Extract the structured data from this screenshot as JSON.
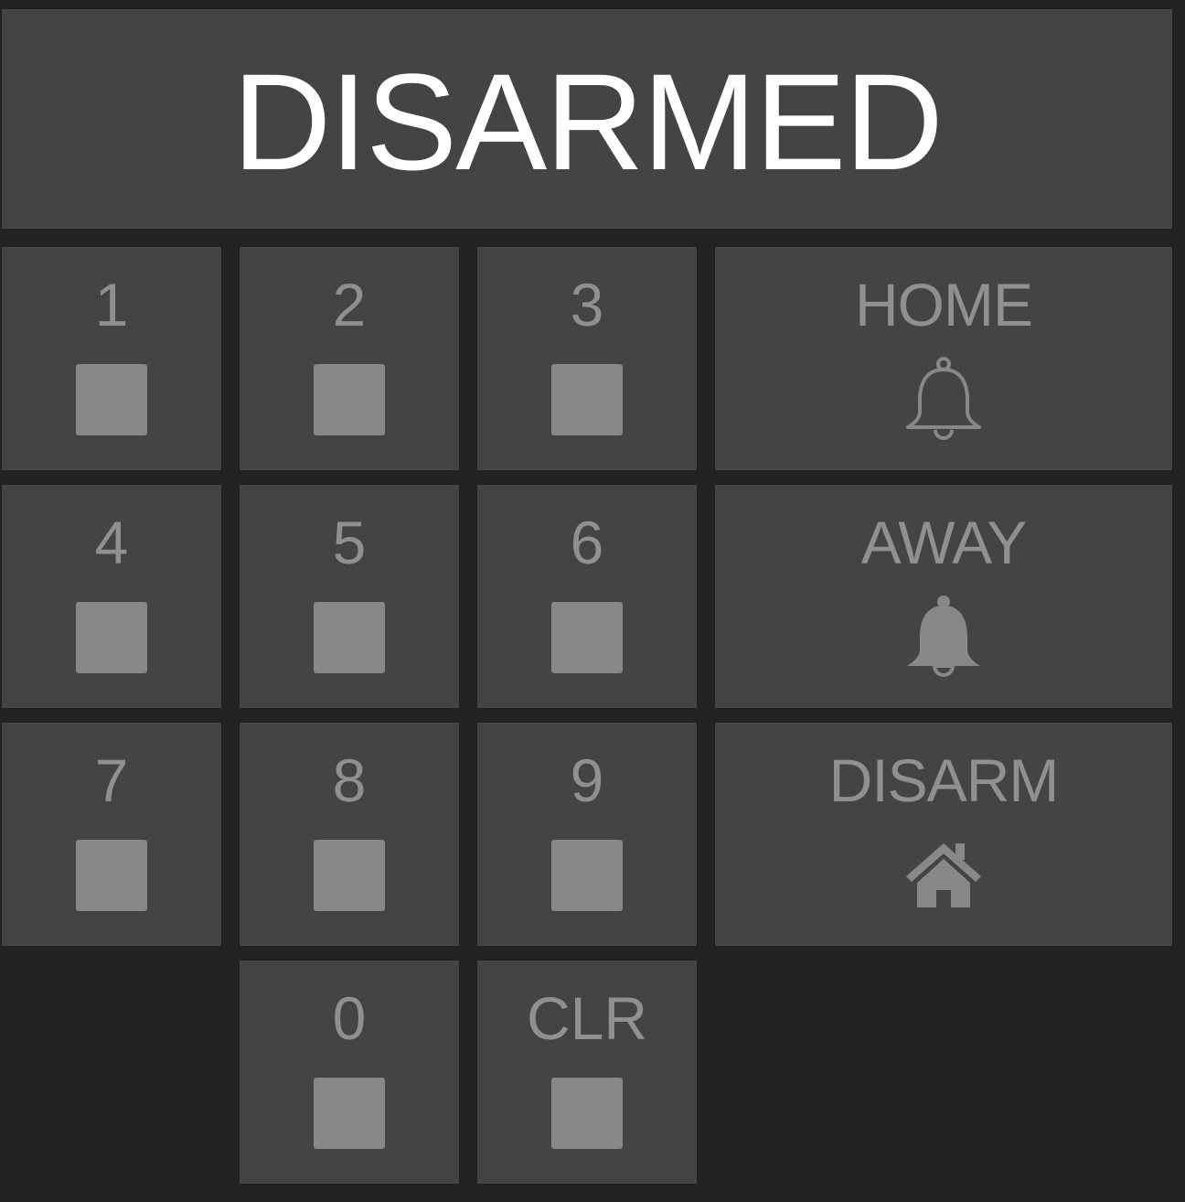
{
  "status": {
    "text": "DISARMED"
  },
  "keypad": {
    "keys": [
      {
        "label": "1"
      },
      {
        "label": "2"
      },
      {
        "label": "3"
      },
      {
        "label": "4"
      },
      {
        "label": "5"
      },
      {
        "label": "6"
      },
      {
        "label": "7"
      },
      {
        "label": "8"
      },
      {
        "label": "9"
      },
      {
        "label": "0"
      },
      {
        "label": "CLR"
      }
    ]
  },
  "modes": {
    "home": {
      "label": "HOME",
      "icon": "bell-outline-icon"
    },
    "away": {
      "label": "AWAY",
      "icon": "bell-filled-icon"
    },
    "disarm": {
      "label": "DISARM",
      "icon": "house-icon"
    }
  },
  "colors": {
    "background": "#222222",
    "panel": "#444444",
    "status_text": "#ffffff",
    "muted_text": "#909090",
    "indicator": "#888888"
  }
}
